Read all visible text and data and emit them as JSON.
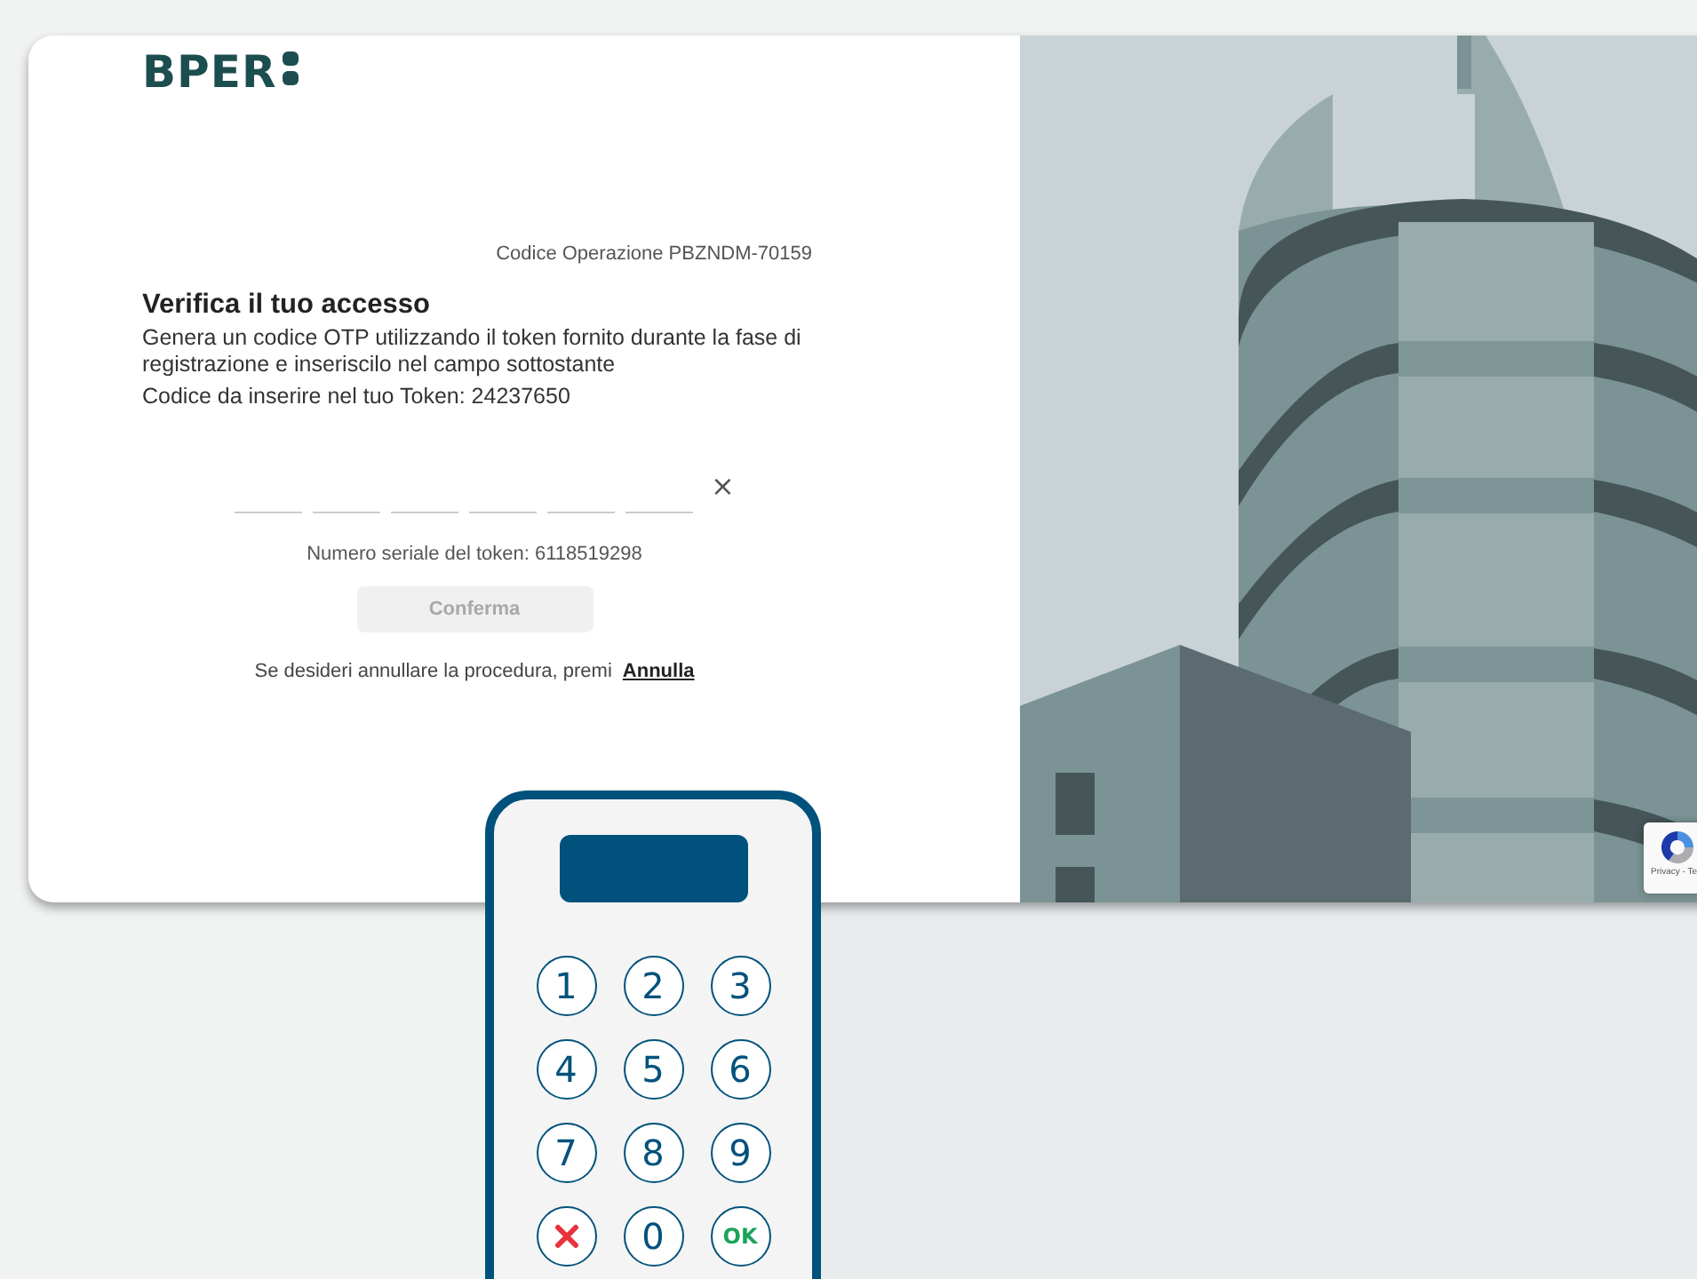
{
  "logo": {
    "text": "BPER"
  },
  "operation_code": "Codice Operazione PBZNDM-70159",
  "heading": "Verifica il tuo accesso",
  "description": "Genera un codice OTP utilizzando il token fornito durante la fase di registrazione e inseriscilo nel campo sottostante",
  "token_code": "Codice da inserire nel tuo Token: 24237650",
  "otp": {
    "fields": [
      {
        "filled": false
      },
      {
        "filled": false
      },
      {
        "filled": false
      },
      {
        "filled": false
      },
      {
        "filled": false
      },
      {
        "filled": false
      }
    ],
    "clear_label": "×"
  },
  "serial": "Numero seriale del token: 6118519298",
  "confirm_button": {
    "label": "Conferma",
    "disabled": true
  },
  "cancel_text": {
    "text": "Se desideri annullare la procedura, premi",
    "link": "Annulla"
  },
  "recaptcha": {
    "text": "Privacy - Te"
  },
  "token_device": {
    "keys": [
      {
        "kind": "digit",
        "label": "1"
      },
      {
        "kind": "digit",
        "label": "2"
      },
      {
        "kind": "digit",
        "label": "3"
      },
      {
        "kind": "digit",
        "label": "4"
      },
      {
        "kind": "digit",
        "label": "5"
      },
      {
        "kind": "digit",
        "label": "6"
      },
      {
        "kind": "digit",
        "label": "7"
      },
      {
        "kind": "digit",
        "label": "8"
      },
      {
        "kind": "digit",
        "label": "9"
      },
      {
        "kind": "cancel"
      },
      {
        "kind": "digit",
        "label": "0"
      },
      {
        "kind": "ok",
        "label": "OK"
      }
    ]
  }
}
